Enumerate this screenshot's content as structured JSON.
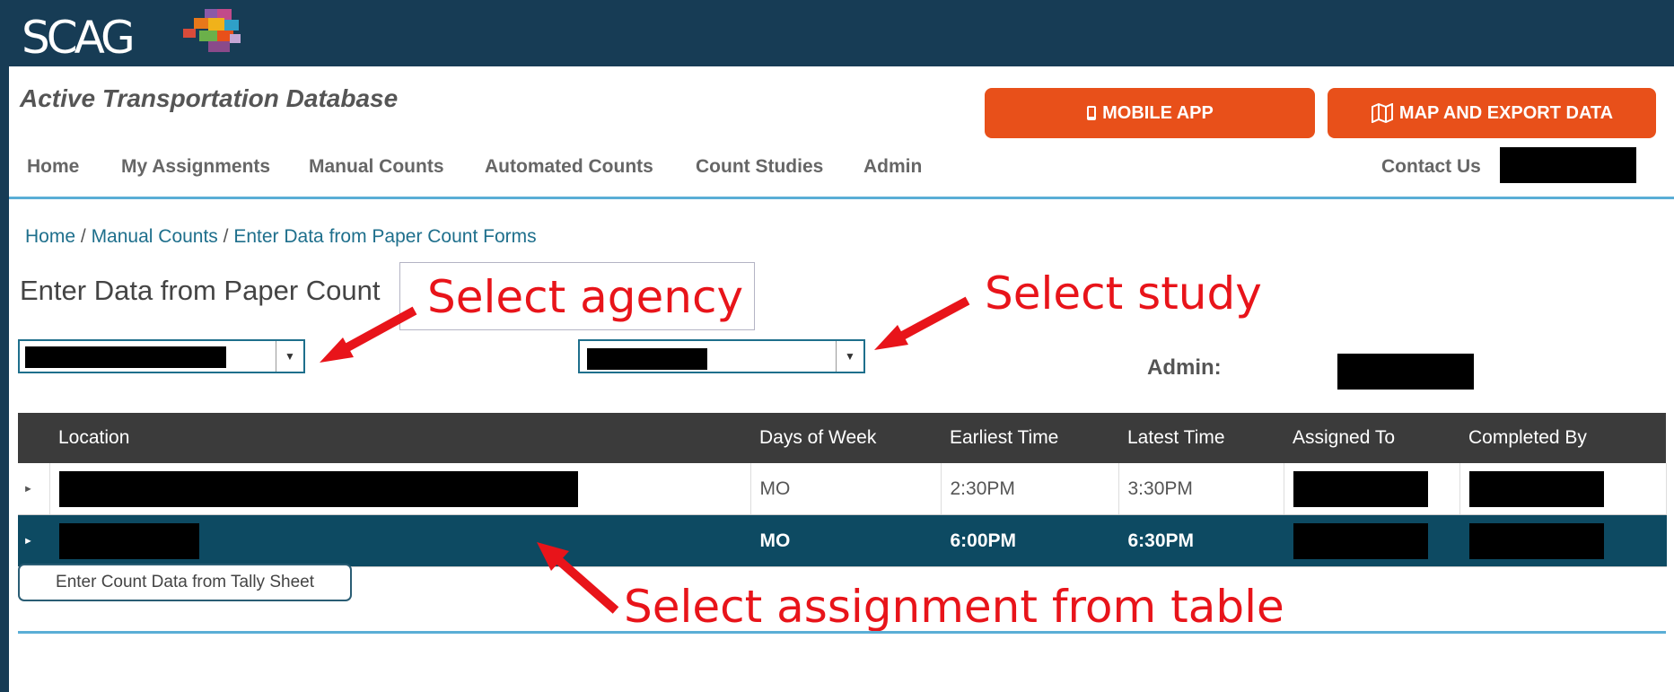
{
  "brand": {
    "logo_text": "SCAG"
  },
  "header": {
    "app_title": "Active Transportation Database",
    "mobile_app_label": "MOBILE APP",
    "map_export_label": "MAP AND EXPORT DATA"
  },
  "nav": {
    "items": [
      "Home",
      "My Assignments",
      "Manual Counts",
      "Automated Counts",
      "Count Studies",
      "Admin"
    ],
    "contact_label": "Contact Us"
  },
  "breadcrumb": [
    "Home",
    "/",
    "Manual Counts",
    "/",
    "Enter Data from Paper Count Forms"
  ],
  "page": {
    "title": "Enter Data from Paper Count",
    "admin_label": "Admin:"
  },
  "annotations": {
    "agency": "Select agency",
    "study": "Select study",
    "assignment": "Select assignment from table"
  },
  "table": {
    "columns": [
      "Location",
      "Days of Week",
      "Earliest Time",
      "Latest Time",
      "Assigned To",
      "Completed By"
    ],
    "rows": [
      {
        "days": "MO",
        "earliest": "2:30PM",
        "latest": "3:30PM",
        "selected": false
      },
      {
        "days": "MO",
        "earliest": "6:00PM",
        "latest": "6:30PM",
        "selected": true
      }
    ]
  },
  "actions": {
    "tally_button": "Enter Count Data from Tally Sheet"
  },
  "colors": {
    "header_bg": "#173c55",
    "accent_orange": "#e8501a",
    "selected_row": "#0d4a62",
    "annotation_red": "#e8141a",
    "rule_blue": "#5aaed6"
  }
}
